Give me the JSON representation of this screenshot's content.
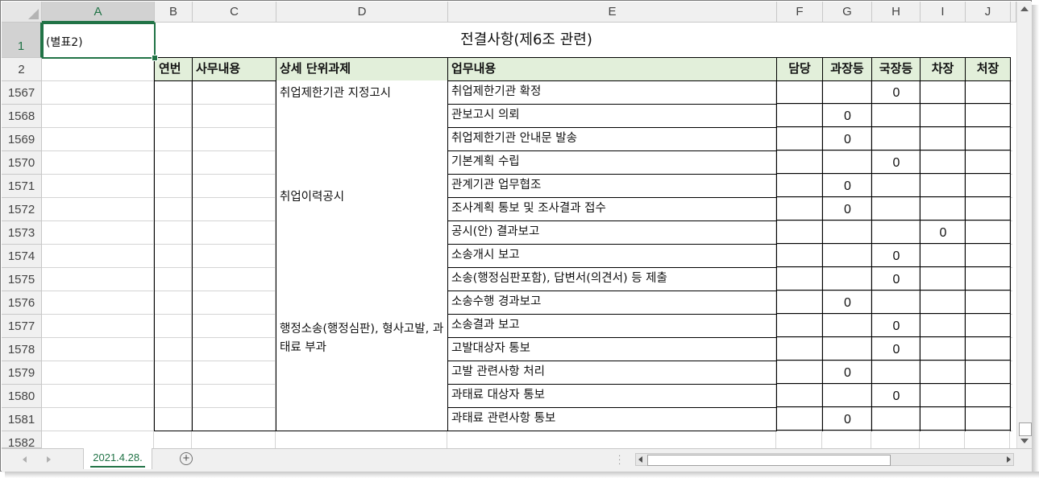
{
  "sheet": {
    "name_box_selected": "A",
    "columns": [
      "A",
      "B",
      "C",
      "D",
      "E",
      "F",
      "G",
      "H",
      "I",
      "J"
    ],
    "row_numbers": [
      "1",
      "2",
      "1567",
      "1568",
      "1569",
      "1570",
      "1571",
      "1572",
      "1573",
      "1574",
      "1575",
      "1576",
      "1577",
      "1578",
      "1579",
      "1580",
      "1581",
      "1582"
    ],
    "cells": {
      "a1": "(별표2)",
      "title": "전결사항(제6조 관련)",
      "headers": {
        "b": "연번",
        "c": "사무내용",
        "d": "상세 단위과제",
        "e": "업무내용",
        "f": "담당",
        "g": "과장등",
        "h": "국장등",
        "i": "차장",
        "j": "처장"
      },
      "groups": [
        {
          "d": "취업제한기관 지정고시"
        },
        {
          "d": "취업이력공시"
        },
        {
          "d": "행정소송(행정심판), 형사고발, 과태료 부과"
        }
      ],
      "rows": [
        {
          "e": "취업제한기관 확정",
          "g": "",
          "h": "0",
          "i": ""
        },
        {
          "e": "관보고시 의뢰",
          "g": "0",
          "h": "",
          "i": ""
        },
        {
          "e": "취업제한기관 안내문 발송",
          "g": "0",
          "h": "",
          "i": ""
        },
        {
          "e": "기본계획 수립",
          "g": "",
          "h": "0",
          "i": ""
        },
        {
          "e": "관계기관 업무협조",
          "g": "0",
          "h": "",
          "i": ""
        },
        {
          "e": "조사계획 통보 및 조사결과 접수",
          "g": "0",
          "h": "",
          "i": ""
        },
        {
          "e": "공시(안) 결과보고",
          "g": "",
          "h": "",
          "i": "0"
        },
        {
          "e": "소송개시 보고",
          "g": "",
          "h": "0",
          "i": ""
        },
        {
          "e": "소송(행정심판포함), 답변서(의견서) 등 제출",
          "g": "",
          "h": "0",
          "i": ""
        },
        {
          "e": "소송수행 경과보고",
          "g": "0",
          "h": "",
          "i": ""
        },
        {
          "e": "소송결과 보고",
          "g": "",
          "h": "0",
          "i": ""
        },
        {
          "e": "고발대상자 통보",
          "g": "",
          "h": "0",
          "i": ""
        },
        {
          "e": "고발 관련사항 처리",
          "g": "0",
          "h": "",
          "i": ""
        },
        {
          "e": "과태료 대상자 통보",
          "g": "",
          "h": "0",
          "i": ""
        },
        {
          "e": "과태료 관련사항 통보",
          "g": "0",
          "h": "",
          "i": ""
        }
      ]
    }
  },
  "tabs": {
    "active": "2021.4.28.",
    "add_label": "+"
  },
  "colors": {
    "accent": "#217346",
    "header_fill": "#e2efda"
  }
}
